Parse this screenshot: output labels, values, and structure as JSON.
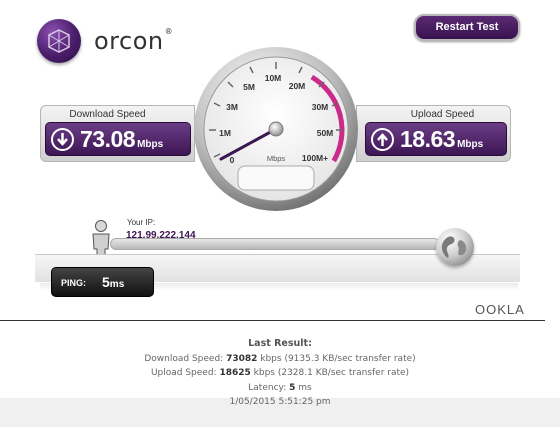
{
  "brand": {
    "name": "orcon",
    "reg": "®"
  },
  "header": {
    "restart_label": "Restart Test"
  },
  "download": {
    "title": "Download Speed",
    "value": "73.08",
    "unit": "Mbps"
  },
  "upload": {
    "title": "Upload Speed",
    "value": "18.63",
    "unit": "Mbps"
  },
  "gauge": {
    "ticks": [
      "0",
      "1M",
      "3M",
      "5M",
      "10M",
      "20M",
      "30M",
      "50M",
      "100M+"
    ],
    "unit_label": "Mbps",
    "needle_value": "0"
  },
  "connection": {
    "ip_label": "Your IP:",
    "ip": "121.99.222.144"
  },
  "ping": {
    "label": "PING:",
    "value": "5",
    "unit": "ms"
  },
  "ookla": "OOKLA",
  "results": {
    "title": "Last Result:",
    "download_label": "Download Speed:",
    "download_kbps": "73082",
    "download_rest": "kbps (9135.3 KB/sec transfer rate)",
    "upload_label": "Upload Speed:",
    "upload_kbps": "18625",
    "upload_rest": "kbps (2328.1 KB/sec transfer rate)",
    "latency_label": "Latency:",
    "latency_value": "5",
    "latency_unit": "ms",
    "timestamp": "1/05/2015 5:51:25 pm"
  },
  "colors": {
    "brand_purple": "#3d1654",
    "gauge_arc": "#cc2a8a"
  }
}
